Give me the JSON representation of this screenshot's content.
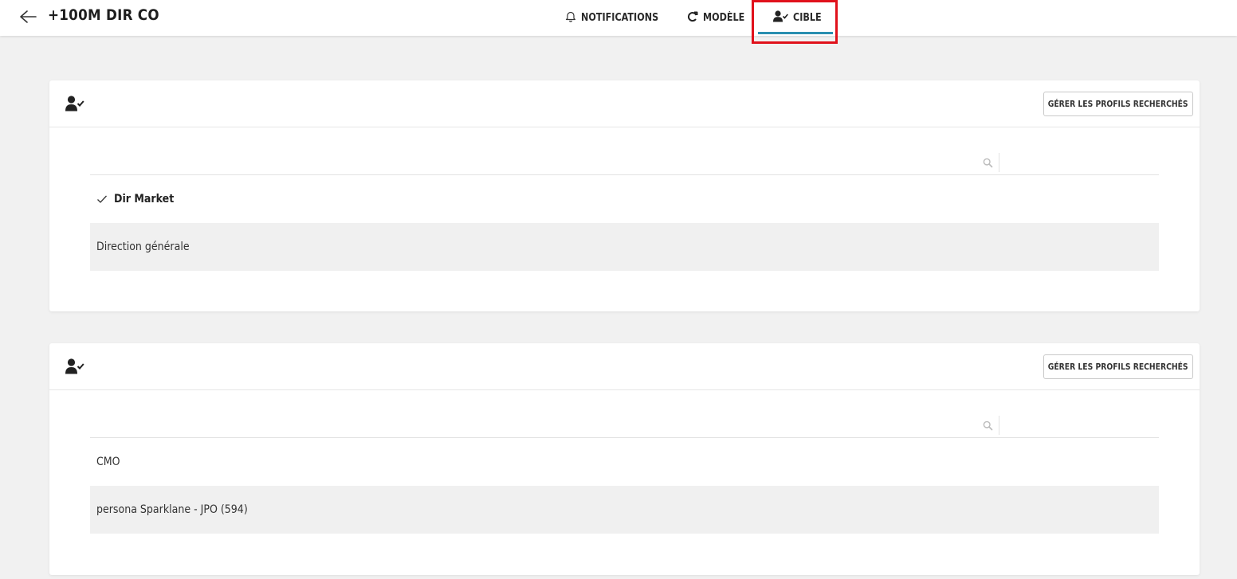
{
  "header": {
    "title": "+100M DIR CO",
    "back_icon": "arrow-left-icon",
    "tabs": [
      {
        "label": "NOTIFICATIONS",
        "icon": "bell-icon",
        "active": false
      },
      {
        "label": "MODÈLE",
        "icon": "refresh-icon",
        "active": false
      },
      {
        "label": "CIBLE",
        "icon": "user-check-icon",
        "active": true
      }
    ],
    "accent_color": "#2a8fb0",
    "highlight_color": "#e0111b"
  },
  "cards": [
    {
      "icon": "user-check-icon",
      "manage_button_label": "GÉRER LES PROFILS RECHERCHÉS",
      "search": {
        "value": "",
        "placeholder": ""
      },
      "items": [
        {
          "label": "Dir Market",
          "selected": true
        },
        {
          "label": "Direction générale",
          "selected": false
        }
      ]
    },
    {
      "icon": "user-check-icon",
      "manage_button_label": "GÉRER LES PROFILS RECHERCHÉS",
      "search": {
        "value": "",
        "placeholder": ""
      },
      "items": [
        {
          "label": "CMO",
          "selected": false
        },
        {
          "label": "persona Sparklane - JPO (594)",
          "selected": false
        }
      ]
    }
  ]
}
